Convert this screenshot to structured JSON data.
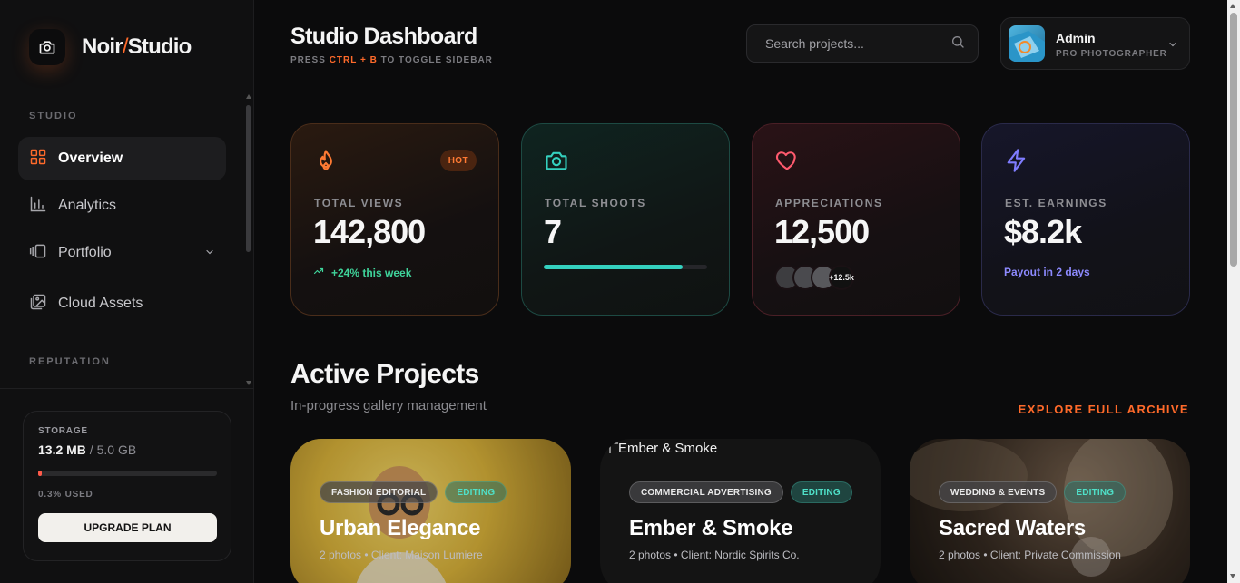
{
  "brand": {
    "name_left": "Noir",
    "slash": "/",
    "name_right": "Studio"
  },
  "sidebar": {
    "sections": [
      "STUDIO",
      "REPUTATION"
    ],
    "items": [
      {
        "label": "Overview",
        "icon": "grid-icon",
        "active": true
      },
      {
        "label": "Analytics",
        "icon": "bar-chart-icon"
      },
      {
        "label": "Portfolio",
        "icon": "portfolio-icon",
        "expandable": true
      },
      {
        "label": "Cloud Assets",
        "icon": "images-icon"
      }
    ],
    "storage": {
      "title": "STORAGE",
      "used": "13.2 MB",
      "total": " / 5.0 GB",
      "percent": 0.3,
      "used_label": "0.3% USED",
      "button": "UPGRADE PLAN"
    }
  },
  "header": {
    "title": "Studio Dashboard",
    "hint_pre": "PRESS ",
    "hint_key": "CTRL + B",
    "hint_post": " TO TOGGLE SIDEBAR",
    "search_placeholder": "Search projects...",
    "user_name": "Admin",
    "user_role": "PRO PHOTOGRAPHER"
  },
  "stats": [
    {
      "label": "TOTAL VIEWS",
      "value": "142,800",
      "badge": "HOT",
      "note": "+24% this week",
      "icon": "flame-icon",
      "accent": "#ff7a33"
    },
    {
      "label": "TOTAL SHOOTS",
      "value": "7",
      "progress": 0.85,
      "icon": "camera-icon",
      "accent": "#34d1bf"
    },
    {
      "label": "APPRECIATIONS",
      "value": "12,500",
      "faces_extra": "+12.5k",
      "icon": "heart-icon",
      "accent": "#ff5a6e"
    },
    {
      "label": "EST. EARNINGS",
      "value": "$8.2k",
      "note": "Payout in 2 days",
      "icon": "bolt-icon",
      "accent": "#7f7cff"
    }
  ],
  "projects": {
    "title": "Active Projects",
    "subtitle": "In-progress gallery management",
    "explore": "EXPLORE FULL ARCHIVE",
    "items": [
      {
        "category": "FASHION EDITORIAL",
        "status": "EDITING",
        "title": "Urban Elegance",
        "meta": "2 photos • Client: Maison Lumiere"
      },
      {
        "category": "COMMERCIAL ADVERTISING",
        "status": "EDITING",
        "title": "Ember & Smoke",
        "meta": "2 photos • Client: Nordic Spirits Co.",
        "alt": "Ember & Smoke"
      },
      {
        "category": "WEDDING & EVENTS",
        "status": "EDITING",
        "title": "Sacred Waters",
        "meta": "2 photos • Client: Private Commission"
      }
    ]
  }
}
